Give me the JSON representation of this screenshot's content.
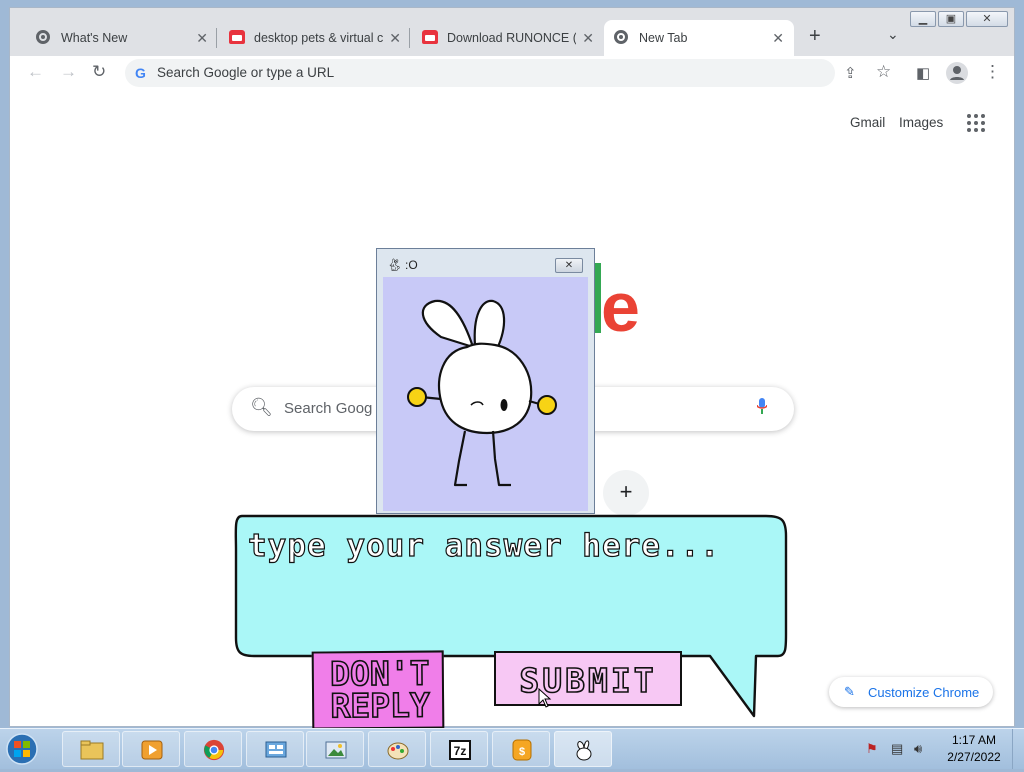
{
  "browser": {
    "tabs": [
      {
        "label": "What's New",
        "icon": "chrome-icon"
      },
      {
        "label": "desktop pets & virtual c",
        "icon": "itch-icon"
      },
      {
        "label": "Download RUNONCE (n",
        "icon": "itch-icon"
      },
      {
        "label": "New Tab",
        "icon": "chrome-icon",
        "active": true
      }
    ],
    "new_tab_symbol": "+",
    "omnibox_placeholder": "Search Google or type a URL"
  },
  "newtab": {
    "gmail": "Gmail",
    "images": "Images",
    "search_placeholder": "Search Goog",
    "logo_visible_letter": "e",
    "add_shortcut": "+",
    "customize": "Customize Chrome"
  },
  "pet_window": {
    "title": ":O"
  },
  "dialog": {
    "placeholder": "type your answer here...",
    "dont_reply_line1": "DON'T",
    "dont_reply_line2": "REPLY",
    "submit": "SUBMIT"
  },
  "taskbar": {
    "time": "1:17 AM",
    "date": "2/27/2022",
    "apps": [
      "file-explorer-icon",
      "media-player-icon",
      "chrome-icon",
      "control-panel-icon",
      "photo-viewer-icon",
      "paint-icon",
      "7zip-icon",
      "itch-app-icon",
      "bunny-pet-icon"
    ]
  },
  "colors": {
    "google_red": "#ea4335",
    "google_green": "#34a853",
    "bubble_fill": "#aaf7f7",
    "dont_reply_fill": "#f07ee9",
    "submit_fill": "#f7c8f4",
    "pet_background": "#c8c9f7"
  }
}
